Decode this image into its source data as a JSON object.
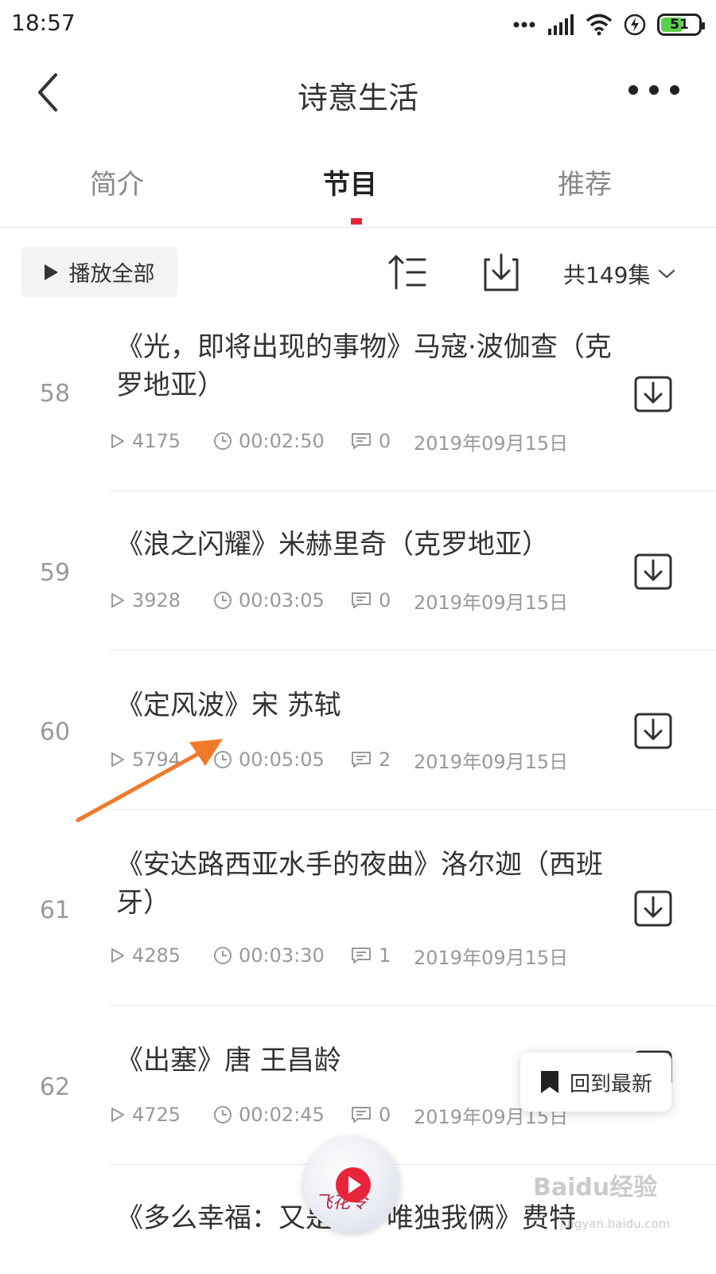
{
  "status_bar": {
    "time": "18:57",
    "battery": "51"
  },
  "nav": {
    "title": "诗意生活"
  },
  "tabs": [
    {
      "label": "简介"
    },
    {
      "label": "节目"
    },
    {
      "label": "推荐"
    }
  ],
  "toolbar": {
    "play_all": "播放全部",
    "count": "共149集"
  },
  "episodes": [
    {
      "num": "58",
      "title": "《光，即将出现的事物》马寇·波伽查（克罗地亚）",
      "plays": "4175",
      "duration": "00:02:50",
      "comments": "0",
      "date": "2019年09月15日"
    },
    {
      "num": "59",
      "title": "《浪之闪耀》米赫里奇（克罗地亚）",
      "plays": "3928",
      "duration": "00:03:05",
      "comments": "0",
      "date": "2019年09月15日"
    },
    {
      "num": "60",
      "title": "《定风波》宋 苏轼",
      "plays": "5794",
      "duration": "00:05:05",
      "comments": "2",
      "date": "2019年09月15日"
    },
    {
      "num": "61",
      "title": "《安达路西亚水手的夜曲》洛尔迦（西班牙）",
      "plays": "4285",
      "duration": "00:03:30",
      "comments": "1",
      "date": "2019年09月15日"
    },
    {
      "num": "62",
      "title": "《出塞》唐 王昌龄",
      "plays": "4725",
      "duration": "00:02:45",
      "comments": "0",
      "date": "2019年09月15日"
    },
    {
      "num": "",
      "title": "《多么幸福：又是夜，唯独我俩》费特",
      "plays": "",
      "duration": "",
      "comments": "",
      "date": ""
    }
  ],
  "float_button": {
    "label": "回到最新"
  },
  "mini_player": {
    "art_text": "飞花令"
  },
  "watermark": {
    "text": "Baidu经验",
    "sub": "jingyan.baidu.com"
  },
  "colors": {
    "accent": "#e8243b",
    "annotation_arrow": "#f07a2a"
  },
  "icons": [
    "back-arrow-icon",
    "more-dots-icon",
    "play-icon",
    "sort-icon",
    "download-icon",
    "chevron-down-icon",
    "clock-icon",
    "comment-icon",
    "bookmark-icon"
  ]
}
